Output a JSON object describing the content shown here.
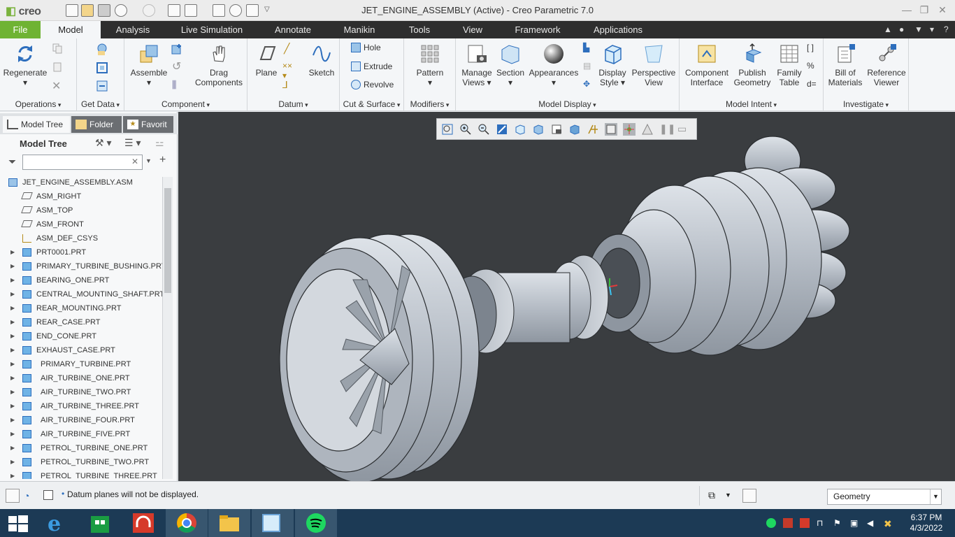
{
  "app": {
    "logo_text": "creo",
    "window_title": "JET_ENGINE_ASSEMBLY (Active) - Creo Parametric 7.0"
  },
  "menu": {
    "tabs": [
      "File",
      "Model",
      "Analysis",
      "Live Simulation",
      "Annotate",
      "Manikin",
      "Tools",
      "View",
      "Framework",
      "Applications"
    ],
    "active_tab": "Model"
  },
  "ribbon": {
    "regenerate": "Regenerate",
    "assemble": "Assemble",
    "drag_components_1": "Drag",
    "drag_components_2": "Components",
    "plane": "Plane",
    "sketch": "Sketch",
    "hole": "Hole",
    "extrude": "Extrude",
    "revolve": "Revolve",
    "pattern": "Pattern",
    "manage_views_1": "Manage",
    "manage_views_2": "Views",
    "section": "Section",
    "appearances": "Appearances",
    "display_style_1": "Display",
    "display_style_2": "Style",
    "perspective_view_1": "Perspective",
    "perspective_view_2": "View",
    "component_interface_1": "Component",
    "component_interface_2": "Interface",
    "publish_geometry_1": "Publish",
    "publish_geometry_2": "Geometry",
    "family_table_1": "Family",
    "family_table_2": "Table",
    "bill_of_materials_1": "Bill of",
    "bill_of_materials_2": "Materials",
    "reference_viewer_1": "Reference",
    "reference_viewer_2": "Viewer",
    "groups": {
      "operations": "Operations",
      "get_data": "Get Data",
      "component": "Component",
      "datum": "Datum",
      "cut_surface": "Cut & Surface",
      "modifiers": "Modifiers",
      "model_display": "Model Display",
      "model_intent": "Model Intent",
      "investigate": "Investigate"
    }
  },
  "left_panel": {
    "tabs": [
      "Model Tree",
      "Folder",
      "Favorit"
    ],
    "header": "Model Tree",
    "filter_placeholder": "",
    "tree": [
      {
        "label": "JET_ENGINE_ASSEMBLY.ASM",
        "type": "asm"
      },
      {
        "label": "ASM_RIGHT",
        "type": "plane"
      },
      {
        "label": "ASM_TOP",
        "type": "plane"
      },
      {
        "label": "ASM_FRONT",
        "type": "plane"
      },
      {
        "label": "ASM_DEF_CSYS",
        "type": "csys"
      },
      {
        "label": "PRT0001.PRT",
        "type": "part"
      },
      {
        "label": "PRIMARY_TURBINE_BUSHING.PRT",
        "type": "part"
      },
      {
        "label": "BEARING_ONE.PRT",
        "type": "part"
      },
      {
        "label": "CENTRAL_MOUNTING_SHAFT.PRT",
        "type": "part"
      },
      {
        "label": "REAR_MOUNTING.PRT",
        "type": "part"
      },
      {
        "label": "REAR_CASE.PRT",
        "type": "part"
      },
      {
        "label": "END_CONE.PRT",
        "type": "part"
      },
      {
        "label": "EXHAUST_CASE.PRT",
        "type": "part"
      },
      {
        "label": "PRIMARY_TURBINE.PRT",
        "type": "part-flag"
      },
      {
        "label": "AIR_TURBINE_ONE.PRT",
        "type": "part-flag"
      },
      {
        "label": "AIR_TURBINE_TWO.PRT",
        "type": "part-flag"
      },
      {
        "label": "AIR_TURBINE_THREE.PRT",
        "type": "part-flag"
      },
      {
        "label": "AIR_TURBINE_FOUR.PRT",
        "type": "part-flag"
      },
      {
        "label": "AIR_TURBINE_FIVE.PRT",
        "type": "part-flag"
      },
      {
        "label": "PETROL_TURBINE_ONE.PRT",
        "type": "part-flag"
      },
      {
        "label": "PETROL_TURBINE_TWO.PRT",
        "type": "part-flag"
      },
      {
        "label": "PETROL_TURBINE_THREE.PRT",
        "type": "part-flag"
      }
    ]
  },
  "status": {
    "message": "Datum planes will not be displayed.",
    "selection_filter": "Geometry"
  },
  "taskbar": {
    "time": "6:37 PM",
    "date": "4/3/2022"
  },
  "colors": {
    "file_tab": "#6fb333",
    "menu_bar": "#2e2e2e",
    "viewport_bg": "#3a3d40",
    "model_surface": "#b8bfc8",
    "taskbar": "#1c3a55"
  }
}
